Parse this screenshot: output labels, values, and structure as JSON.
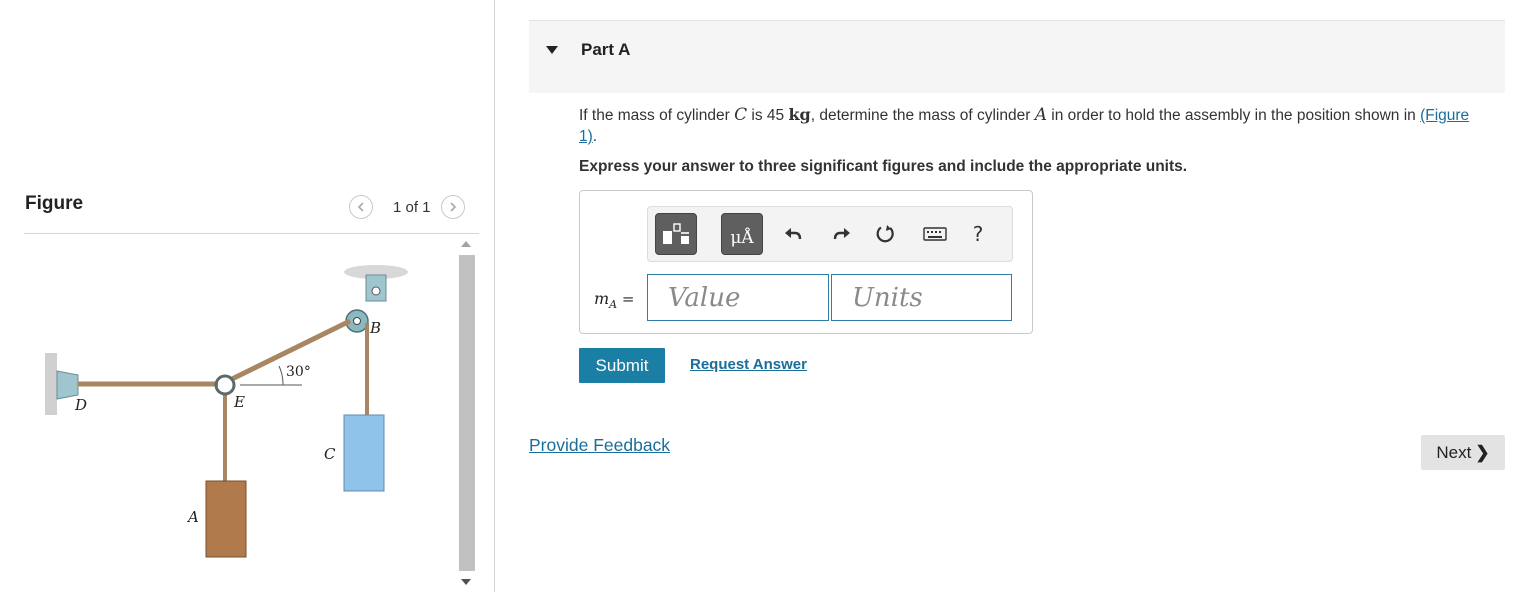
{
  "figure_panel": {
    "title": "Figure",
    "page_counter": "1 of 1",
    "labels": {
      "angle": "30°",
      "point_b": "B",
      "point_c": "C",
      "point_d": "D",
      "point_e": "E",
      "point_a": "A"
    }
  },
  "part": {
    "title": "Part A",
    "question_prefix": "If the mass of cylinder ",
    "question_var1": "C",
    "question_mid1": " is 45 ",
    "question_unit": "kg",
    "question_mid2": ", determine the mass of cylinder ",
    "question_var2": "A",
    "question_suffix": " in order to hold the assembly in the position shown in ",
    "figure_link": "(Figure 1)",
    "question_end": ".",
    "instructions": "Express your answer to three significant figures and include the appropriate units."
  },
  "answer": {
    "label_var": "m",
    "label_sub": "A",
    "label_eq": " =",
    "value_placeholder": "Value",
    "units_placeholder": "Units",
    "toolbar": {
      "units_button_label": "μÅ",
      "help_label": "?"
    }
  },
  "actions": {
    "submit": "Submit",
    "request_answer": "Request Answer",
    "provide_feedback": "Provide Feedback",
    "next": "Next",
    "next_chevron": "❯"
  },
  "colors": {
    "primary": "#1b7ea5",
    "link": "#1a6e9a",
    "cylinder_c": "#8fc3ea",
    "cylinder_a": "#b07a4c",
    "rope": "#a88663"
  }
}
